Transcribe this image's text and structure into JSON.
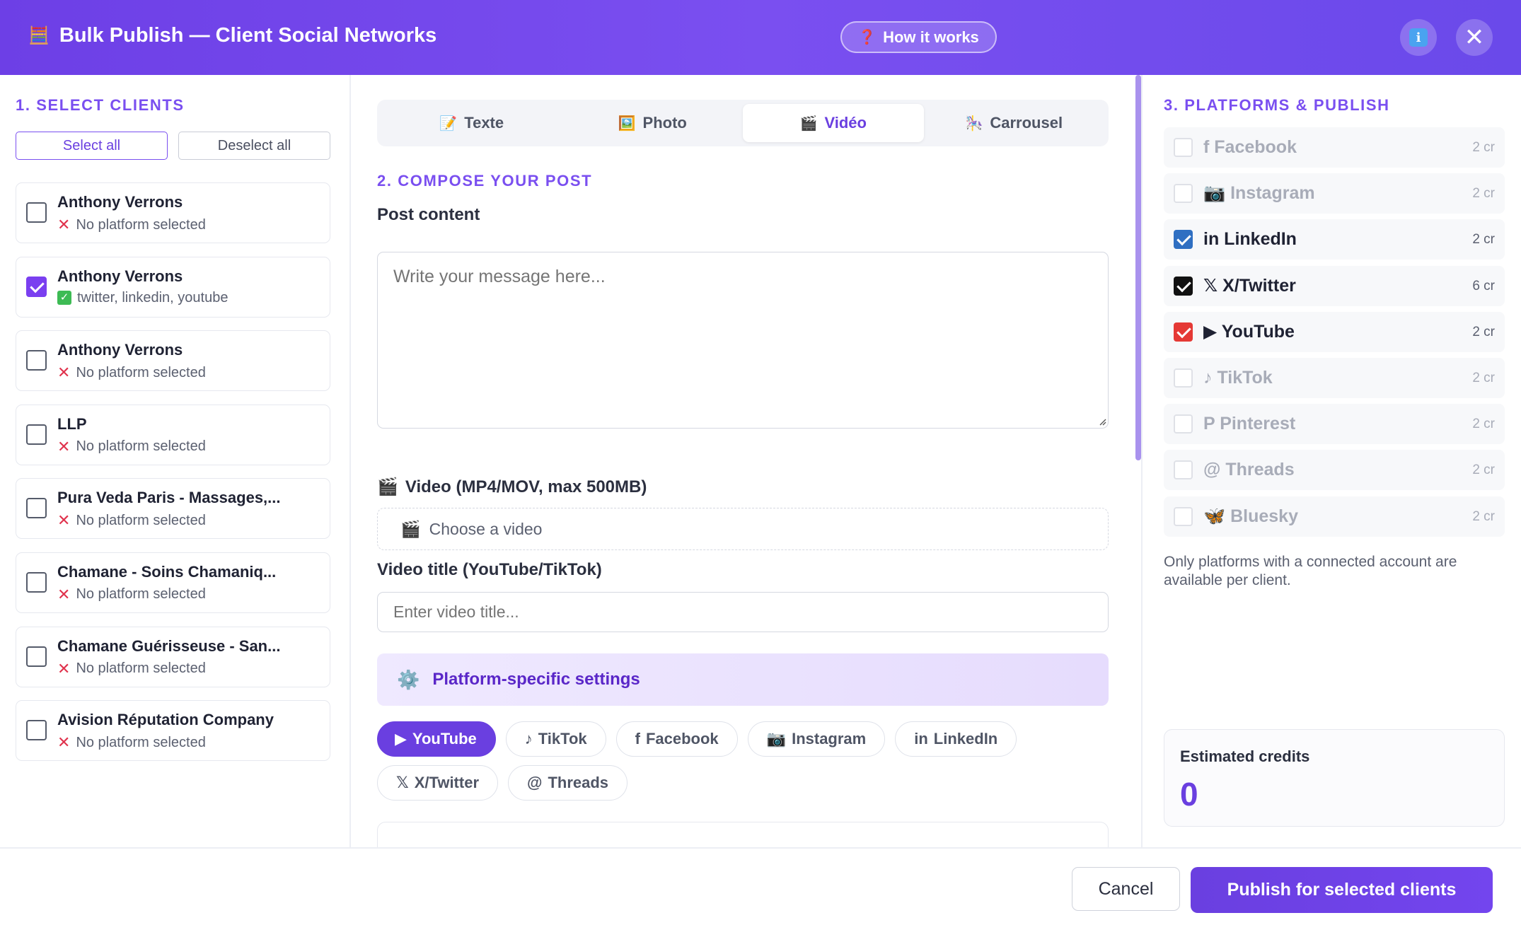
{
  "header": {
    "title": "Bulk Publish — Client Social Networks",
    "title_icon": "🧮",
    "how_it_works": "How it works",
    "how_icon": "❓",
    "info_icon": "i",
    "close_icon": "✕"
  },
  "clients_panel": {
    "section_title": "1. SELECT CLIENTS",
    "select_all": "Select all",
    "deselect_all": "Deselect all",
    "clients": [
      {
        "name": "Anthony Verrons",
        "status": "No platform selected",
        "checked": false
      },
      {
        "name": "Anthony Verrons",
        "status": "twitter, linkedin, youtube",
        "checked": true
      },
      {
        "name": "Anthony Verrons",
        "status": "No platform selected",
        "checked": false
      },
      {
        "name": "LLP",
        "status": "No platform selected",
        "checked": false
      },
      {
        "name": "Pura Veda Paris - Massages,...",
        "status": "No platform selected",
        "checked": false
      },
      {
        "name": "Chamane - Soins Chamaniq...",
        "status": "No platform selected",
        "checked": false
      },
      {
        "name": "Chamane Guérisseuse - San...",
        "status": "No platform selected",
        "checked": false
      },
      {
        "name": "Avision Réputation Company",
        "status": "No platform selected",
        "checked": false
      }
    ]
  },
  "compose": {
    "tabs": [
      {
        "icon": "📝",
        "label": "Texte"
      },
      {
        "icon": "🖼️",
        "label": "Photo"
      },
      {
        "icon": "🎬",
        "label": "Vidéo"
      },
      {
        "icon": "🎠",
        "label": "Carrousel"
      }
    ],
    "active_tab": "Vidéo",
    "section_title": "2. COMPOSE YOUR POST",
    "post_content_label": "Post content",
    "post_placeholder": "Write your message here...",
    "video_label": "Video (MP4/MOV, max 500MB)",
    "video_icon": "🎬",
    "choose_video": "Choose a video",
    "video_title_label": "Video title (YouTube/TikTok)",
    "video_title_placeholder": "Enter video title...",
    "platform_settings": "Platform-specific settings",
    "platform_settings_icon": "⚙️",
    "platform_pills": [
      {
        "icon": "▶",
        "label": "YouTube",
        "active": true
      },
      {
        "icon": "♪",
        "label": "TikTok",
        "active": false
      },
      {
        "icon": "f",
        "label": "Facebook",
        "active": false
      },
      {
        "icon": "📷",
        "label": "Instagram",
        "active": false
      },
      {
        "icon": "in",
        "label": "LinkedIn",
        "active": false
      },
      {
        "icon": "𝕏",
        "label": "X/Twitter",
        "active": false
      },
      {
        "icon": "@",
        "label": "Threads",
        "active": false
      }
    ]
  },
  "platforms_panel": {
    "section_title": "3. PLATFORMS & PUBLISH",
    "platforms": [
      {
        "icon": "f",
        "label": "Facebook",
        "cost": "2 cr",
        "checked": false,
        "color": ""
      },
      {
        "icon": "📷",
        "label": "Instagram",
        "cost": "2 cr",
        "checked": false,
        "color": ""
      },
      {
        "icon": "in",
        "label": "LinkedIn",
        "cost": "2 cr",
        "checked": true,
        "color": "#2f6fc2"
      },
      {
        "icon": "𝕏",
        "label": "X/Twitter",
        "cost": "6 cr",
        "checked": true,
        "color": "#111111"
      },
      {
        "icon": "▶",
        "label": "YouTube",
        "cost": "2 cr",
        "checked": true,
        "color": "#e53935"
      },
      {
        "icon": "♪",
        "label": "TikTok",
        "cost": "2 cr",
        "checked": false,
        "color": ""
      },
      {
        "icon": "P",
        "label": "Pinterest",
        "cost": "2 cr",
        "checked": false,
        "color": ""
      },
      {
        "icon": "@",
        "label": "Threads",
        "cost": "2 cr",
        "checked": false,
        "color": ""
      },
      {
        "icon": "🦋",
        "label": "Bluesky",
        "cost": "2 cr",
        "checked": false,
        "color": ""
      }
    ],
    "availability_note": "Only platforms with a connected account are available per client.",
    "estimated_credits_label": "Estimated credits",
    "estimated_credits_value": "0"
  },
  "footer": {
    "cancel": "Cancel",
    "publish": "Publish for selected clients"
  },
  "colors": {
    "accent": "#6a3fe0",
    "header_gradient_start": "#6d3fe6",
    "error": "#e0334d",
    "success": "#3dbb54"
  }
}
